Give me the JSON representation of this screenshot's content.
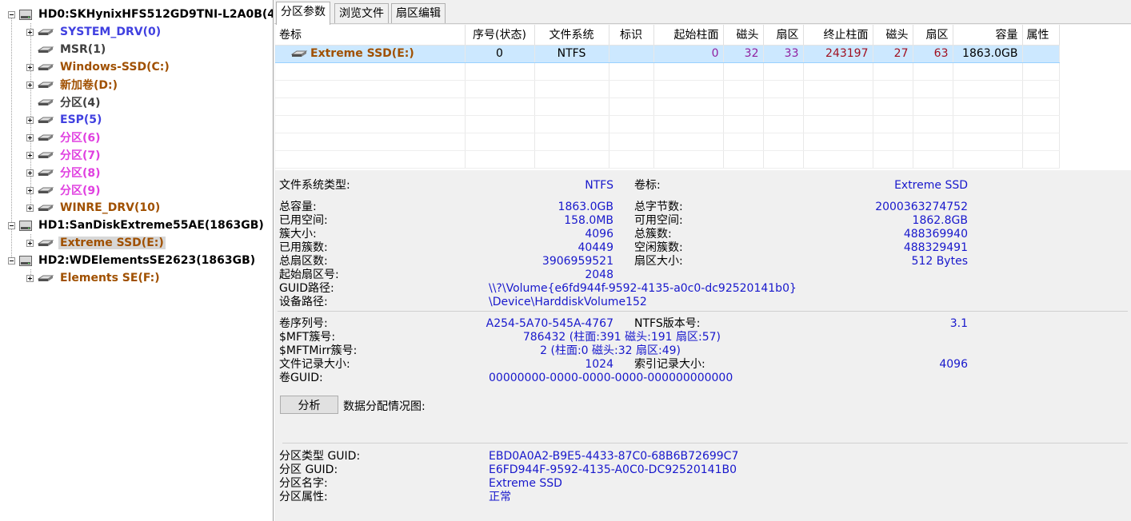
{
  "tree": {
    "disks": [
      {
        "label": "HD0:SKHynixHFS512GD9TNI-L2A0B(4",
        "partitions": [
          {
            "label": "SYSTEM_DRV(0)",
            "color": "#4040e0",
            "expandable": true
          },
          {
            "label": "MSR(1)",
            "color": "#404040",
            "expandable": false
          },
          {
            "label": "Windows-SSD(C:)",
            "color": "#a05000",
            "expandable": true
          },
          {
            "label": "新加卷(D:)",
            "color": "#a05000",
            "expandable": true
          },
          {
            "label": "分区(4)",
            "color": "#404040",
            "expandable": false
          },
          {
            "label": "ESP(5)",
            "color": "#4040e0",
            "expandable": true
          },
          {
            "label": "分区(6)",
            "color": "#e040e0",
            "expandable": true
          },
          {
            "label": "分区(7)",
            "color": "#e040e0",
            "expandable": true
          },
          {
            "label": "分区(8)",
            "color": "#e040e0",
            "expandable": true
          },
          {
            "label": "分区(9)",
            "color": "#e040e0",
            "expandable": true
          },
          {
            "label": "WINRE_DRV(10)",
            "color": "#a05000",
            "expandable": true
          }
        ]
      },
      {
        "label": "HD1:SanDiskExtreme55AE(1863GB)",
        "partitions": [
          {
            "label": "Extreme SSD(E:)",
            "color": "#a05000",
            "expandable": true,
            "selected": true
          }
        ]
      },
      {
        "label": "HD2:WDElementsSE2623(1863GB)",
        "partitions": [
          {
            "label": "Elements SE(F:)",
            "color": "#a05000",
            "expandable": true
          }
        ]
      }
    ]
  },
  "tabs": [
    "分区参数",
    "浏览文件",
    "扇区编辑"
  ],
  "grid": {
    "headers": [
      "卷标",
      "序号(状态)",
      "文件系统",
      "标识",
      "起始柱面",
      "磁头",
      "扇区",
      "终止柱面",
      "磁头",
      "扇区",
      "容量",
      "属性"
    ],
    "row": {
      "volume": "Extreme SSD(E:)",
      "index": "0",
      "fs": "NTFS",
      "flag": "",
      "start_cyl": "0",
      "start_head": "32",
      "start_sector": "33",
      "end_cyl": "243197",
      "end_head": "27",
      "end_sector": "63",
      "capacity": "1863.0GB",
      "attr": ""
    }
  },
  "info": {
    "fs_type_label": "文件系统类型:",
    "fs_type": "NTFS",
    "vol_label_label": "卷标:",
    "vol_label": "Extreme SSD",
    "total_cap_label": "总容量:",
    "total_cap": "1863.0GB",
    "total_bytes_label": "总字节数:",
    "total_bytes": "2000363274752",
    "used_label": "已用空间:",
    "used": "158.0MB",
    "free_label": "可用空间:",
    "free": "1862.8GB",
    "cluster_size_label": "簇大小:",
    "cluster_size": "4096",
    "total_clusters_label": "总簇数:",
    "total_clusters": "488369940",
    "used_clusters_label": "已用簇数:",
    "used_clusters": "40449",
    "free_clusters_label": "空闲簇数:",
    "free_clusters": "488329491",
    "total_sectors_label": "总扇区数:",
    "total_sectors": "3906959521",
    "sector_size_label": "扇区大小:",
    "sector_size": "512 Bytes",
    "start_sector_label": "起始扇区号:",
    "start_sector": "2048",
    "guid_path_label": "GUID路径:",
    "guid_path": "\\\\?\\Volume{e6fd944f-9592-4135-a0c0-dc92520141b0}",
    "device_path_label": "设备路径:",
    "device_path": "\\Device\\HarddiskVolume152",
    "serial_label": "卷序列号:",
    "serial": "A254-5A70-545A-4767",
    "ntfs_ver_label": "NTFS版本号:",
    "ntfs_ver": "3.1",
    "mft_label": "$MFT簇号:",
    "mft": "786432 (柱面:391 磁头:191 扇区:57)",
    "mftmirr_label": "$MFTMirr簇号:",
    "mftmirr": "2 (柱面:0 磁头:32 扇区:49)",
    "record_size_label": "文件记录大小:",
    "record_size": "1024",
    "index_size_label": "索引记录大小:",
    "index_size": "4096",
    "vol_guid_label": "卷GUID:",
    "vol_guid": "00000000-0000-0000-0000-000000000000",
    "analyze_label": "分析",
    "alloc_map_label": "数据分配情况图:",
    "ptype_guid_label": "分区类型 GUID:",
    "ptype_guid": "EBD0A0A2-B9E5-4433-87C0-68B6B72699C7",
    "p_guid_label": "分区 GUID:",
    "p_guid": "E6FD944F-9592-4135-A0C0-DC92520141B0",
    "p_name_label": "分区名字:",
    "p_name": "Extreme SSD",
    "p_attr_label": "分区属性:",
    "p_attr": "正常"
  }
}
